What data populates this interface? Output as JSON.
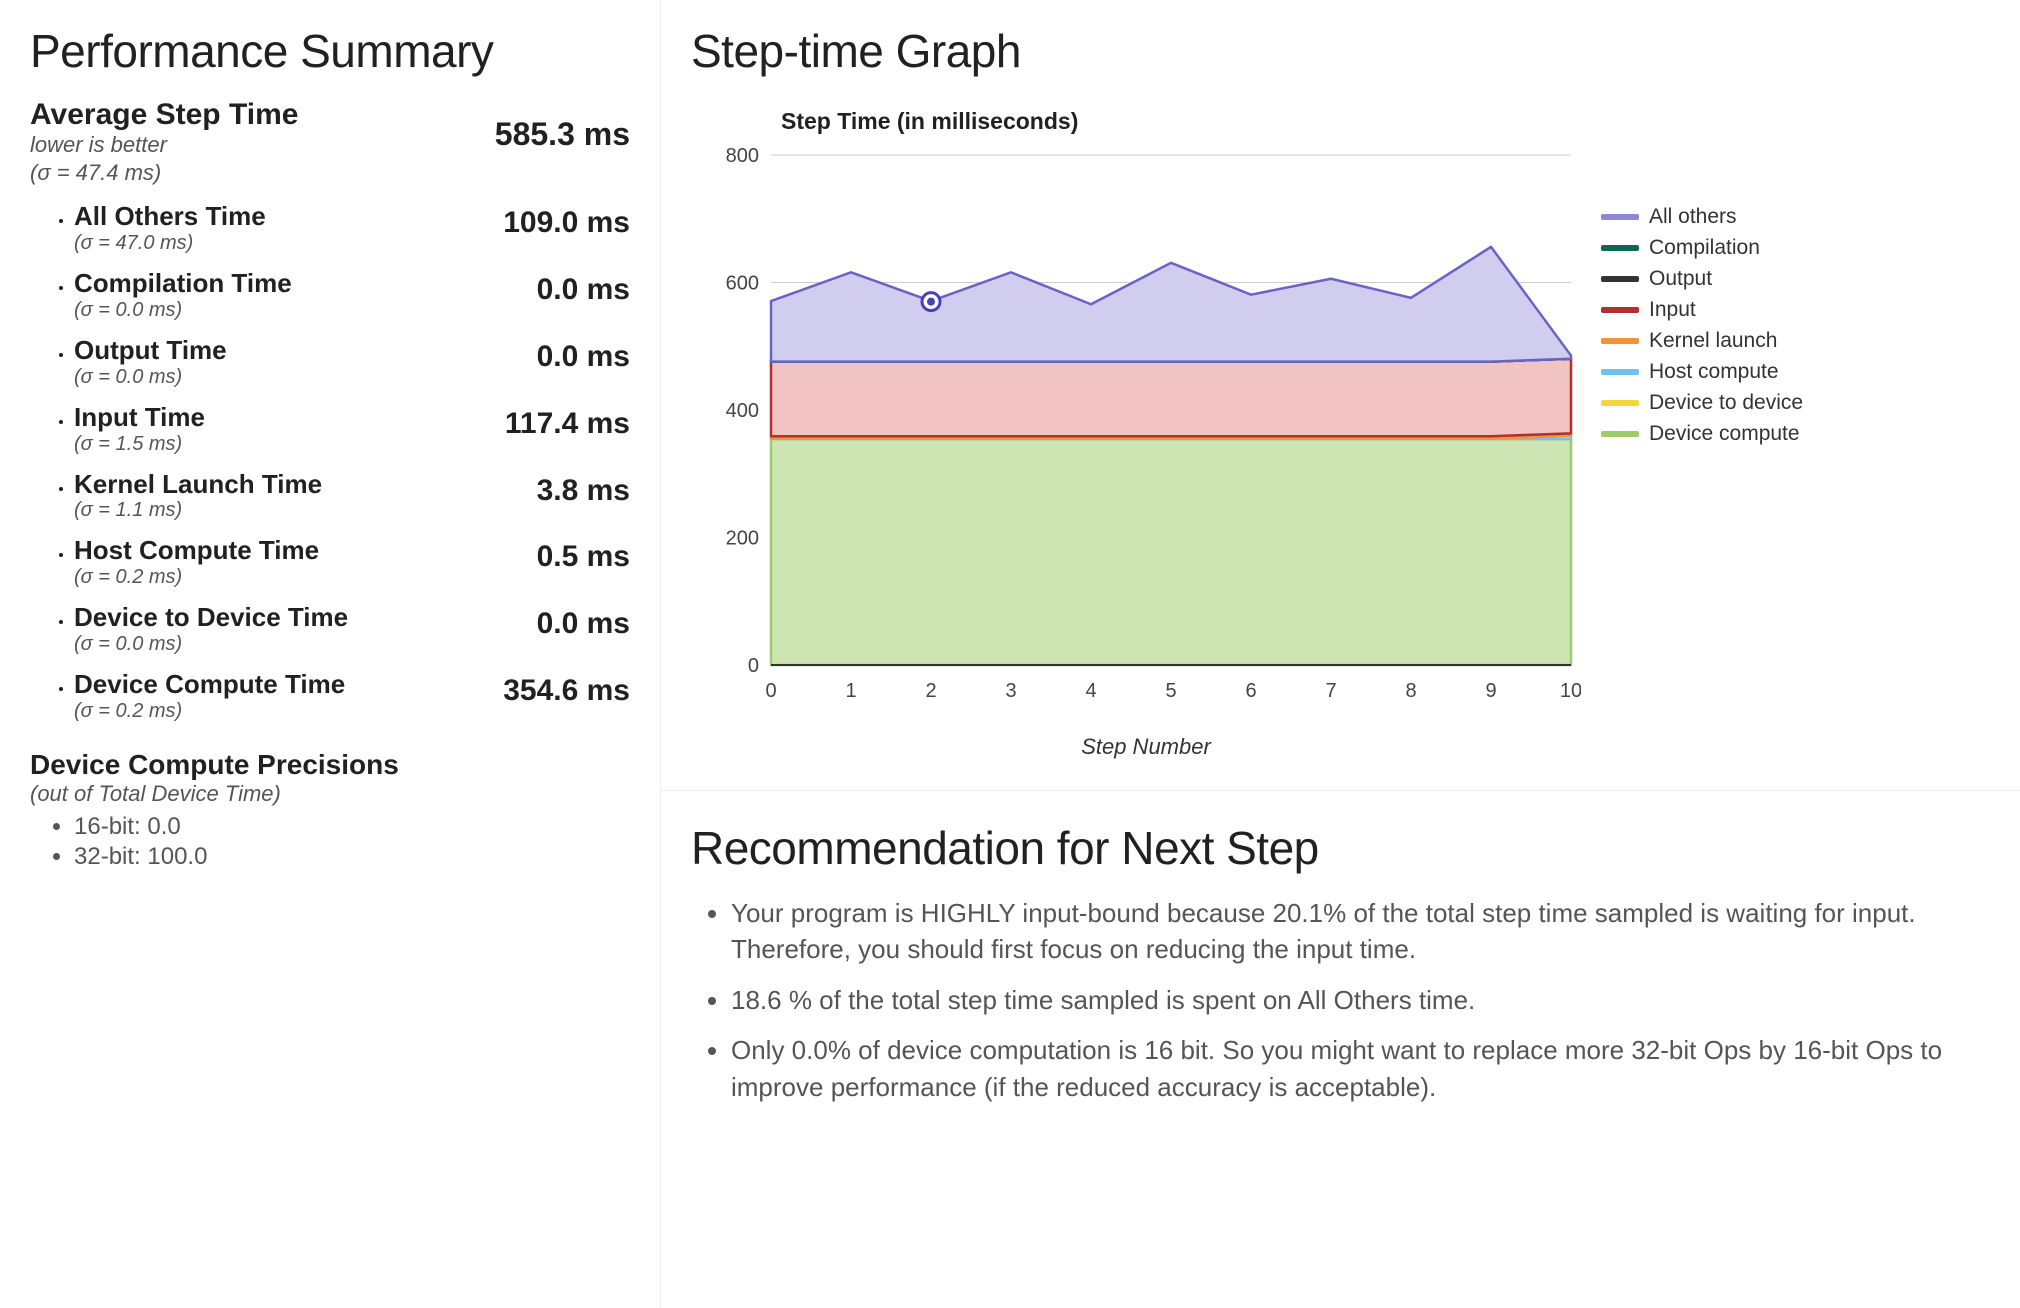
{
  "summary": {
    "title": "Performance Summary",
    "avg": {
      "label": "Average Step Time",
      "sub1": "lower is better",
      "sub2": "(σ = 47.4 ms)",
      "value": "585.3 ms"
    },
    "metrics": [
      {
        "label": "All Others Time",
        "sigma": "(σ = 47.0 ms)",
        "value": "109.0 ms"
      },
      {
        "label": "Compilation Time",
        "sigma": "(σ = 0.0 ms)",
        "value": "0.0 ms"
      },
      {
        "label": "Output Time",
        "sigma": "(σ = 0.0 ms)",
        "value": "0.0 ms"
      },
      {
        "label": "Input Time",
        "sigma": "(σ = 1.5 ms)",
        "value": "117.4 ms"
      },
      {
        "label": "Kernel Launch Time",
        "sigma": "(σ = 1.1 ms)",
        "value": "3.8 ms"
      },
      {
        "label": "Host Compute Time",
        "sigma": "(σ = 0.2 ms)",
        "value": "0.5 ms"
      },
      {
        "label": "Device to Device Time",
        "sigma": "(σ = 0.0 ms)",
        "value": "0.0 ms"
      },
      {
        "label": "Device Compute Time",
        "sigma": "(σ = 0.2 ms)",
        "value": "354.6 ms"
      }
    ],
    "precisions": {
      "title": "Device Compute Precisions",
      "sub": "(out of Total Device Time)",
      "items": [
        "16-bit: 0.0",
        "32-bit: 100.0"
      ]
    }
  },
  "graph": {
    "title": "Step-time Graph",
    "chart_title": "Step Time (in milliseconds)",
    "xlabel": "Step Number",
    "legend": [
      {
        "name": "All others",
        "color": "#8d86d9"
      },
      {
        "name": "Compilation",
        "color": "#0d6851"
      },
      {
        "name": "Output",
        "color": "#333333"
      },
      {
        "name": "Input",
        "color": "#b12f2f"
      },
      {
        "name": "Kernel launch",
        "color": "#f2923c"
      },
      {
        "name": "Host compute",
        "color": "#6fc5e9"
      },
      {
        "name": "Device to device",
        "color": "#f2d83c"
      },
      {
        "name": "Device compute",
        "color": "#9bcb6a"
      }
    ]
  },
  "recs": {
    "title": "Recommendation for Next Step",
    "items": [
      "Your program is HIGHLY input-bound because 20.1% of the total step time sampled is waiting for input. Therefore, you should first focus on reducing the input time.",
      "18.6 % of the total step time sampled is spent on All Others time.",
      "Only 0.0% of device computation is 16 bit. So you might want to replace more 32-bit Ops by 16-bit Ops to improve performance (if the reduced accuracy is acceptable)."
    ]
  },
  "chart_data": {
    "type": "area",
    "title": "Step Time (in milliseconds)",
    "xlabel": "Step Number",
    "ylabel": "",
    "x": [
      0,
      1,
      2,
      3,
      4,
      5,
      6,
      7,
      8,
      9,
      10
    ],
    "ylim": [
      0,
      800
    ],
    "xlim": [
      0,
      10
    ],
    "y_ticks": [
      0,
      200,
      400,
      600,
      800
    ],
    "x_ticks": [
      0,
      1,
      2,
      3,
      4,
      5,
      6,
      7,
      8,
      9,
      10
    ],
    "marker": {
      "x": 2,
      "y": 570
    },
    "series": [
      {
        "name": "Device compute",
        "color": "#cde4b3",
        "stroke": "#9bcb6a",
        "values": [
          354.6,
          354.6,
          354.6,
          354.6,
          354.6,
          354.6,
          354.6,
          354.6,
          354.6,
          354.6,
          354.6
        ]
      },
      {
        "name": "Device to device",
        "color": "#faf0b6",
        "stroke": "#f2d83c",
        "values": [
          0,
          0,
          0,
          0,
          0,
          0,
          0,
          0,
          0,
          0,
          0
        ]
      },
      {
        "name": "Host compute",
        "color": "#c8e9f7",
        "stroke": "#6fc5e9",
        "values": [
          0.5,
          0.5,
          0.5,
          0.5,
          0.5,
          0.5,
          0.5,
          0.5,
          0.5,
          0.5,
          5
        ]
      },
      {
        "name": "Kernel launch",
        "color": "#fbd5b0",
        "stroke": "#f2923c",
        "values": [
          3.8,
          3.8,
          3.8,
          3.8,
          3.8,
          3.8,
          3.8,
          3.8,
          3.8,
          3.8,
          3.8
        ]
      },
      {
        "name": "Input",
        "color": "#f2c3c3",
        "stroke": "#b12f2f",
        "values": [
          117,
          117,
          117,
          117,
          117,
          117,
          117,
          117,
          117,
          117,
          117
        ]
      },
      {
        "name": "Output",
        "color": "#bfbfbf",
        "stroke": "#333333",
        "values": [
          0,
          0,
          0,
          0,
          0,
          0,
          0,
          0,
          0,
          0,
          0
        ]
      },
      {
        "name": "Compilation",
        "color": "#a9d6c9",
        "stroke": "#0d6851",
        "values": [
          0,
          0,
          0,
          0,
          0,
          0,
          0,
          0,
          0,
          0,
          0
        ]
      },
      {
        "name": "All others",
        "color": "#d1cdee",
        "stroke": "#6b62c7",
        "values": [
          95,
          140,
          95,
          140,
          90,
          155,
          105,
          130,
          100,
          180,
          5
        ]
      }
    ]
  }
}
